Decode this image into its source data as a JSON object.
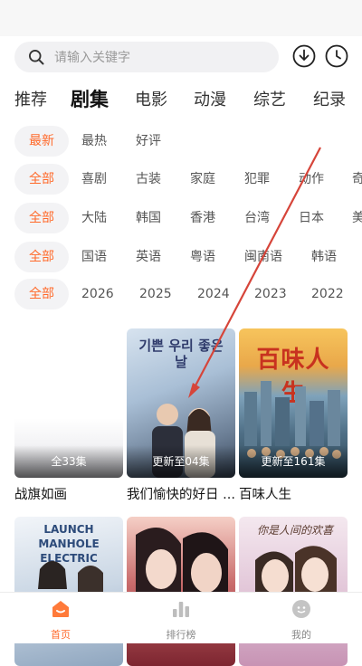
{
  "search": {
    "placeholder": "请输入关键字"
  },
  "categories": [
    "推荐",
    "剧集",
    "电影",
    "动漫",
    "综艺",
    "纪录"
  ],
  "active_category": "剧集",
  "filters": {
    "sort": [
      "最新",
      "最热",
      "好评"
    ],
    "genre": [
      "全部",
      "喜剧",
      "古装",
      "家庭",
      "犯罪",
      "动作",
      "奇"
    ],
    "region": [
      "全部",
      "大陆",
      "韩国",
      "香港",
      "台湾",
      "日本",
      "美"
    ],
    "language": [
      "全部",
      "国语",
      "英语",
      "粤语",
      "闽南语",
      "韩语"
    ],
    "year": [
      "全部",
      "2026",
      "2025",
      "2024",
      "2023",
      "2022"
    ]
  },
  "cards": [
    {
      "title": "战旗如画",
      "episodes": "全33集",
      "poster_colors": [
        "#ffffff",
        "#e9e9ee"
      ]
    },
    {
      "title": "我们愉快的好日 ...",
      "episodes": "更新至04集",
      "poster_colors": [
        "#b9c9dc",
        "#5d6f84"
      ],
      "poster_text": "기쁜 우리 좋은 날"
    },
    {
      "title": "百味人生",
      "episodes": "更新至161集",
      "poster_colors": [
        "#f2a94a",
        "#2d5a7a"
      ],
      "poster_text": "百味人生"
    },
    {
      "title": "",
      "episodes": "",
      "poster_colors": [
        "#e6eef6",
        "#8aa3be"
      ],
      "poster_text": "LAUNCH MANHOLE ELECTRIC"
    },
    {
      "title": "",
      "episodes": "",
      "poster_colors": [
        "#f3c9c0",
        "#8e2f32"
      ]
    },
    {
      "title": "",
      "episodes": "",
      "poster_colors": [
        "#e9d6e8",
        "#c28db0"
      ],
      "poster_text": "你是人间的欢喜"
    }
  ],
  "bottom_nav": [
    {
      "label": "首页",
      "icon": "home-icon",
      "active": true
    },
    {
      "label": "排行榜",
      "icon": "chart-icon",
      "active": false
    },
    {
      "label": "我的",
      "icon": "profile-icon",
      "active": false
    }
  ],
  "colors": {
    "accent": "#ff6a2b",
    "chip_bg": "#f3f3f5",
    "arrow": "#d6453a"
  }
}
